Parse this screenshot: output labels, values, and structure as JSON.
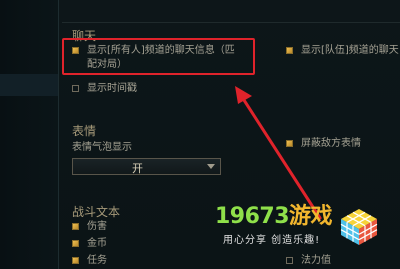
{
  "sections": {
    "chat": "聊天",
    "emote": "表情",
    "combat_text": "战斗文本"
  },
  "chat": {
    "show_all_chat": {
      "label": "显示[所有人]频道的聊天信息（匹配对局）",
      "line1": "显示[所有人]频道的聊天信息（匹",
      "line2": "配对局）",
      "checked": true
    },
    "show_party_chat": {
      "label": "显示[队伍]频道的聊天",
      "checked": true
    },
    "show_timestamp": {
      "label": "显示时间戳",
      "checked": false
    }
  },
  "emote": {
    "bubble_label": "表情气泡显示",
    "bubble_value": "开",
    "block_enemy": {
      "label": "屏蔽敌方表情",
      "checked": true
    }
  },
  "combat_text": {
    "items": [
      {
        "label": "伤害",
        "checked": true
      },
      {
        "label": "金币",
        "checked": true
      },
      {
        "label": "任务",
        "checked": true
      }
    ],
    "right_items": [
      {
        "label": "法力值",
        "checked": false
      }
    ]
  },
  "watermark": {
    "number": "19673",
    "brand": "游戏",
    "slogan": "用心分享  创造乐趣!"
  },
  "colors": {
    "highlight": "#e0232b",
    "checkbox_on": "#f0c050",
    "watermark_green": "#8fe04a",
    "watermark_orange": "#f2b62e"
  }
}
